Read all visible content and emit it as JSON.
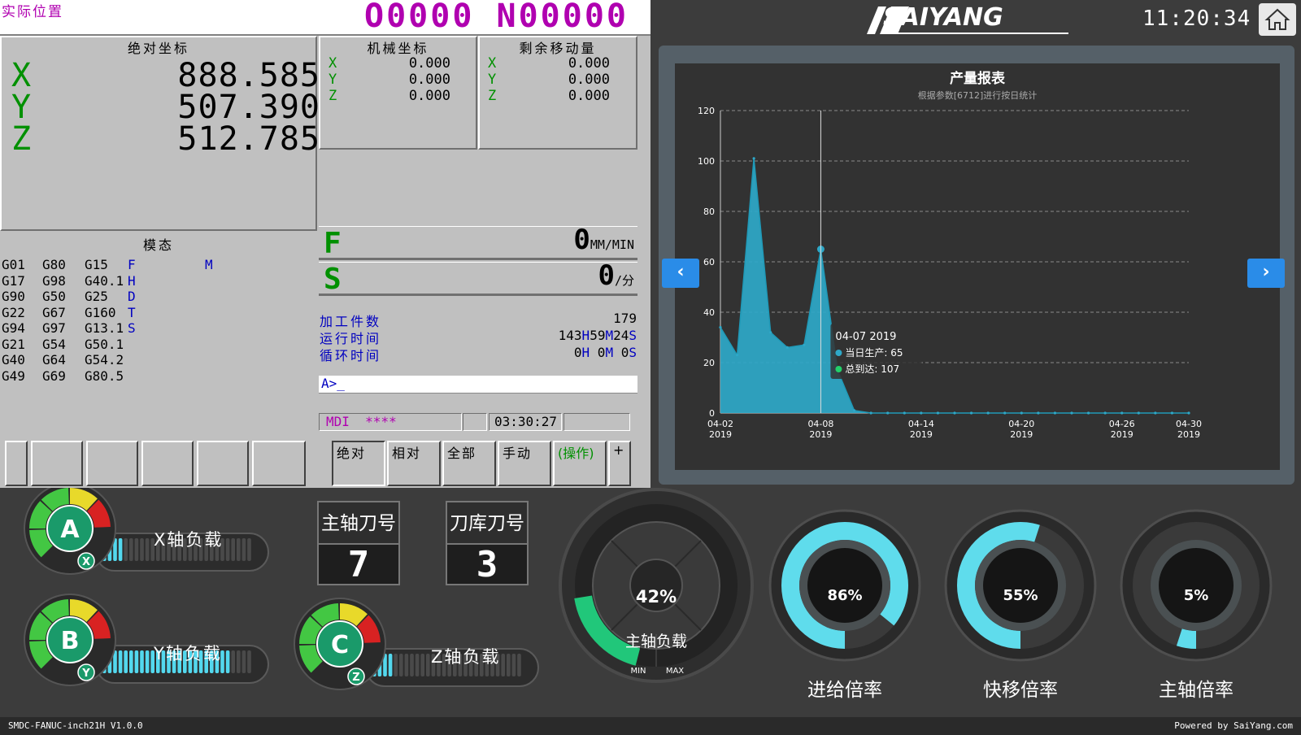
{
  "cnc": {
    "title": "实际位置",
    "program": "O0000 N00000",
    "absolute": {
      "header": "绝对坐标",
      "rows": [
        {
          "axis": "X",
          "value": "888.585"
        },
        {
          "axis": "Y",
          "value": "507.390"
        },
        {
          "axis": "Z",
          "value": "512.785"
        }
      ]
    },
    "machine": {
      "header": "机械坐标",
      "rows": [
        {
          "axis": "X",
          "value": "0.000"
        },
        {
          "axis": "Y",
          "value": "0.000"
        },
        {
          "axis": "Z",
          "value": "0.000"
        }
      ]
    },
    "remaining": {
      "header": "剩余移动量",
      "rows": [
        {
          "axis": "X",
          "value": "0.000"
        },
        {
          "axis": "Y",
          "value": "0.000"
        },
        {
          "axis": "Z",
          "value": "0.000"
        }
      ]
    },
    "modal": {
      "header": "模态",
      "col1": [
        "G01",
        "G17",
        "G90",
        "G22",
        "G94",
        "G21",
        "G40",
        "G49"
      ],
      "col2": [
        "G80",
        "G98",
        "G50",
        "G67",
        "G97",
        "G54",
        "G64",
        "G69"
      ],
      "col3": [
        "G15",
        "G40.1",
        "G25",
        "G160",
        "G13.1",
        "G50.1",
        "G54.2",
        "G80.5"
      ],
      "col4": [
        "F",
        "H",
        "D",
        "T",
        "S",
        "",
        "",
        ""
      ],
      "m_label": "M"
    },
    "feed": {
      "letter": "F",
      "value": "0",
      "unit": "MM/MIN"
    },
    "spindle": {
      "letter": "S",
      "value": "0",
      "unit": "/分"
    },
    "counters": [
      {
        "label": "加工件数",
        "value": "179"
      },
      {
        "label": "运行时间",
        "h": "143",
        "hu": "H",
        "m": "59",
        "mu": "M",
        "s": "24",
        "su": "S"
      },
      {
        "label": "循环时间",
        "h": "0",
        "hu": "H",
        "m": "0",
        "mu": "M",
        "s": "0",
        "su": "S"
      }
    ],
    "prompt": "A>_",
    "status": {
      "mode": "MDI",
      "stars": "****",
      "time": "03:30:27"
    },
    "softkeys": [
      "绝对",
      "相对",
      "全部",
      "手动",
      "(操作)",
      "+"
    ]
  },
  "header": {
    "logo": "SAIYANG",
    "clock": "11:20:34"
  },
  "chart_data": {
    "type": "area",
    "title": "产量报表",
    "subtitle": "根据参数[6712]进行按日统计",
    "x": [
      "04-02",
      "04-03",
      "04-04",
      "04-05",
      "04-06",
      "04-07",
      "04-08",
      "04-09",
      "04-10",
      "04-11",
      "04-12",
      "04-13",
      "04-14",
      "04-15",
      "04-16",
      "04-17",
      "04-18",
      "04-19",
      "04-20",
      "04-21",
      "04-22",
      "04-23",
      "04-24",
      "04-25",
      "04-26",
      "04-27",
      "04-28",
      "04-29",
      "04-30"
    ],
    "x_tick_labels": [
      "04-02",
      "04-08",
      "04-14",
      "04-20",
      "04-26",
      "04-30"
    ],
    "x_tick_year": "2019",
    "series": [
      {
        "name": "当日生产",
        "values": [
          34,
          23,
          101,
          32,
          26,
          27,
          65,
          17,
          1,
          0,
          0,
          0,
          0,
          0,
          0,
          0,
          0,
          0,
          0,
          0,
          0,
          0,
          0,
          0,
          0,
          0,
          0,
          0,
          0
        ]
      }
    ],
    "ylim": [
      0,
      120
    ],
    "yticks": [
      0,
      20,
      40,
      60,
      80,
      100,
      120
    ],
    "grid": true,
    "colors": {
      "area": "#2ea8c8",
      "line": "#1f9ab8",
      "grid": "#8a8a8a"
    },
    "tooltip": {
      "title": "04-07 2019",
      "rows": [
        {
          "label": "当日生产:",
          "value": "65",
          "color": "#2ea8c8"
        },
        {
          "label": "总到达:",
          "value": "107",
          "color": "#22d06a"
        }
      ]
    },
    "highlight_index": 6
  },
  "bottom": {
    "axes": [
      {
        "letter": "A",
        "sub": "X",
        "label": "X轴负载",
        "level": 0.13
      },
      {
        "letter": "B",
        "sub": "Y",
        "label": "Y轴负载",
        "level": 0.85
      },
      {
        "letter": "C",
        "sub": "Z",
        "label": "Z轴负载",
        "level": 0.13
      }
    ],
    "spindle_tool": {
      "title": "主轴刀号",
      "value": "7"
    },
    "magazine_tool": {
      "title": "刀库刀号",
      "value": "3"
    },
    "spindle_load": {
      "value": "42%",
      "label": "主轴负载",
      "min": "MIN",
      "max": "MAX",
      "level": 0.42
    },
    "gauges": [
      {
        "value": "86%",
        "label": "进给倍率",
        "level": 0.86
      },
      {
        "value": "55%",
        "label": "快移倍率",
        "level": 0.55
      },
      {
        "value": "5%",
        "label": "主轴倍率",
        "level": 0.05
      }
    ]
  },
  "footer": {
    "left": "SMDC-FANUC-inch21H V1.0.0",
    "right": "Powered by SaiYang.com"
  }
}
